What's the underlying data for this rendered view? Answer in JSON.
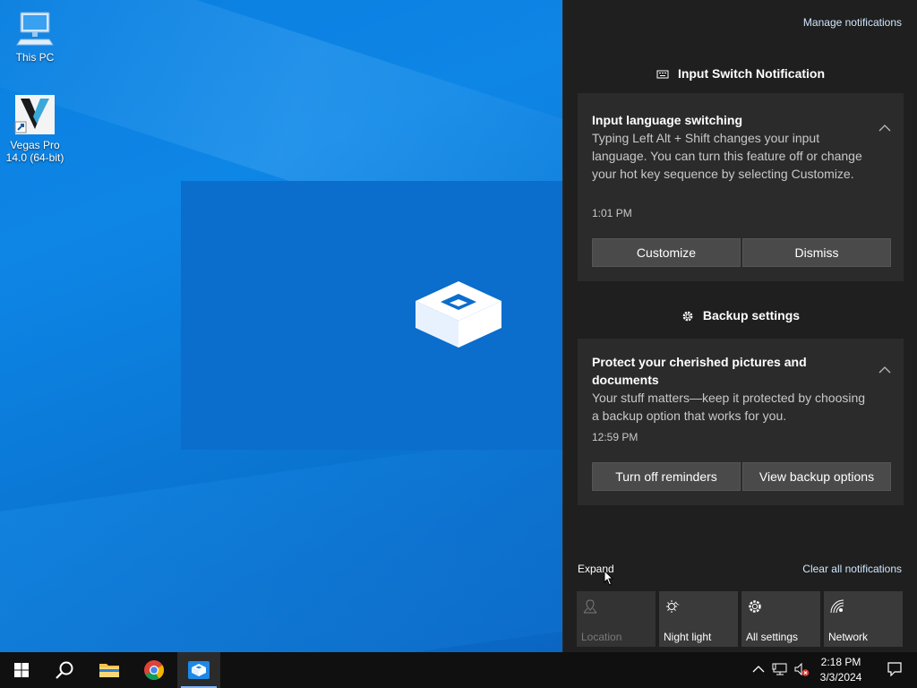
{
  "desktop": {
    "icons": [
      {
        "label": "This PC",
        "icon": "computer-icon"
      },
      {
        "label": "Vegas Pro 14.0 (64-bit)",
        "icon": "vegas-pro-icon"
      }
    ]
  },
  "action_center": {
    "manage_notifications": "Manage notifications",
    "groups": [
      {
        "header": "Input Switch Notification",
        "header_icon": "keyboard-icon",
        "toast": {
          "title": "Input language switching",
          "body": "Typing Left Alt + Shift changes your input language. You can turn this feature off or change your hot key sequence by selecting Customize.",
          "time": "1:01 PM",
          "buttons": [
            "Customize",
            "Dismiss"
          ]
        }
      },
      {
        "header": "Backup settings",
        "header_icon": "gear-icon",
        "toast": {
          "title": "Protect your cherished pictures and documents",
          "body": "Your stuff matters—keep it protected by choosing a backup option that works for you.",
          "time": "12:59 PM",
          "buttons": [
            "Turn off reminders",
            "View backup options"
          ]
        }
      }
    ],
    "expand": "Expand",
    "clear_all": "Clear all notifications",
    "quick_actions": [
      {
        "label": "Location",
        "icon": "location-icon",
        "enabled": false
      },
      {
        "label": "Night light",
        "icon": "night-light-icon",
        "enabled": true
      },
      {
        "label": "All settings",
        "icon": "gear-icon",
        "enabled": true
      },
      {
        "label": "Network",
        "icon": "network-icon",
        "enabled": true
      }
    ]
  },
  "taskbar": {
    "apps": [
      "start",
      "search",
      "file-explorer",
      "chrome",
      "windows-sandbox"
    ],
    "clock": {
      "time": "2:18 PM",
      "date": "3/3/2024"
    }
  }
}
